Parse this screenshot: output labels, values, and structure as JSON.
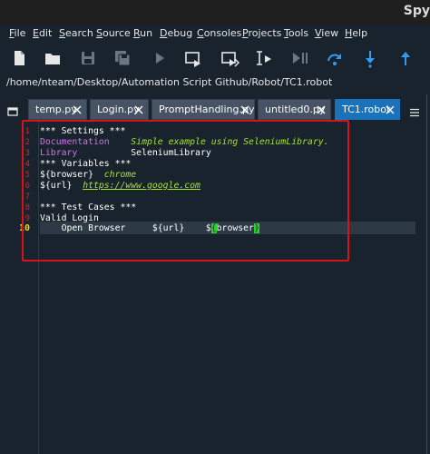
{
  "window": {
    "title": "Spy"
  },
  "menu": [
    {
      "label": "File"
    },
    {
      "label": "Edit"
    },
    {
      "label": "Search"
    },
    {
      "label": "Source"
    },
    {
      "label": "Run"
    },
    {
      "label": "Debug"
    },
    {
      "label": "Consoles"
    },
    {
      "label": "Projects"
    },
    {
      "label": "Tools"
    },
    {
      "label": "View"
    },
    {
      "label": "Help"
    }
  ],
  "toolbar": {
    "icons": [
      "new-file-icon",
      "open-folder-icon",
      "save-icon",
      "save-all-icon",
      "run-icon",
      "run-cell-icon",
      "run-cell-advance-icon",
      "run-selection-icon",
      "debug-icon",
      "step-over-icon",
      "step-into-icon",
      "step-return-icon"
    ]
  },
  "path": {
    "text": "/home/nteam/Desktop/Automation Script Github/Robot/TC1.robot"
  },
  "tabs": [
    {
      "label": "temp.py"
    },
    {
      "label": "Login.py"
    },
    {
      "label": "PromptHandling.py"
    },
    {
      "label": "untitled0.py"
    },
    {
      "label": "TC1.robot",
      "active": true
    }
  ],
  "editor": {
    "line_numbers": [
      "1",
      "2",
      "3",
      "4",
      "5",
      "6",
      "7",
      "8",
      "9",
      "10"
    ],
    "current_line": "10",
    "lines": {
      "l1": "*** Settings ***",
      "l2_kw": "Documentation",
      "l2_val": "Simple example using SeleniumLibrary.",
      "l3_kw": "Library",
      "l3_val": "SeleniumLibrary",
      "l4": "*** Variables ***",
      "l5_var": "${browser}",
      "l5_val": "chrome",
      "l6_var": "${url}",
      "l6_val": "https://www.google.com",
      "l8": "*** Test Cases ***",
      "l9": "Valid Login",
      "l10_a": "    Open Browser     ${url}    $",
      "l10_hl1": "{",
      "l10_b": "browser",
      "l10_hl2": "}"
    }
  },
  "colors": {
    "accent": "#1a72bb",
    "background": "#19232d",
    "highlight_box": "#d8121a"
  }
}
